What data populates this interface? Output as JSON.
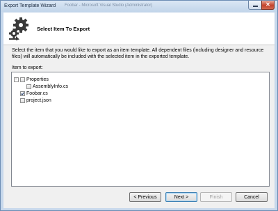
{
  "window": {
    "title": "Export Template Wizard",
    "background_title": "Foobar - Microsoft Visual Studio (Administrator)"
  },
  "header": {
    "title": "Select Item To Export",
    "icon": "gear-icon"
  },
  "description": "Select the item that you would like to export as an item template. All dependent files (including designer and resource files) will automatically be included with the selected item in the exported template.",
  "tree_label": "Item to export:",
  "tree": {
    "items": [
      {
        "label": "Properties",
        "checked": false,
        "expanded": true
      },
      {
        "label": "AssemblyInfo.cs",
        "checked": false
      },
      {
        "label": "Foobar.cs",
        "checked": true
      },
      {
        "label": "project.json",
        "checked": false
      }
    ]
  },
  "buttons": {
    "previous": "< Previous",
    "next": "Next >",
    "finish": "Finish",
    "cancel": "Cancel"
  }
}
